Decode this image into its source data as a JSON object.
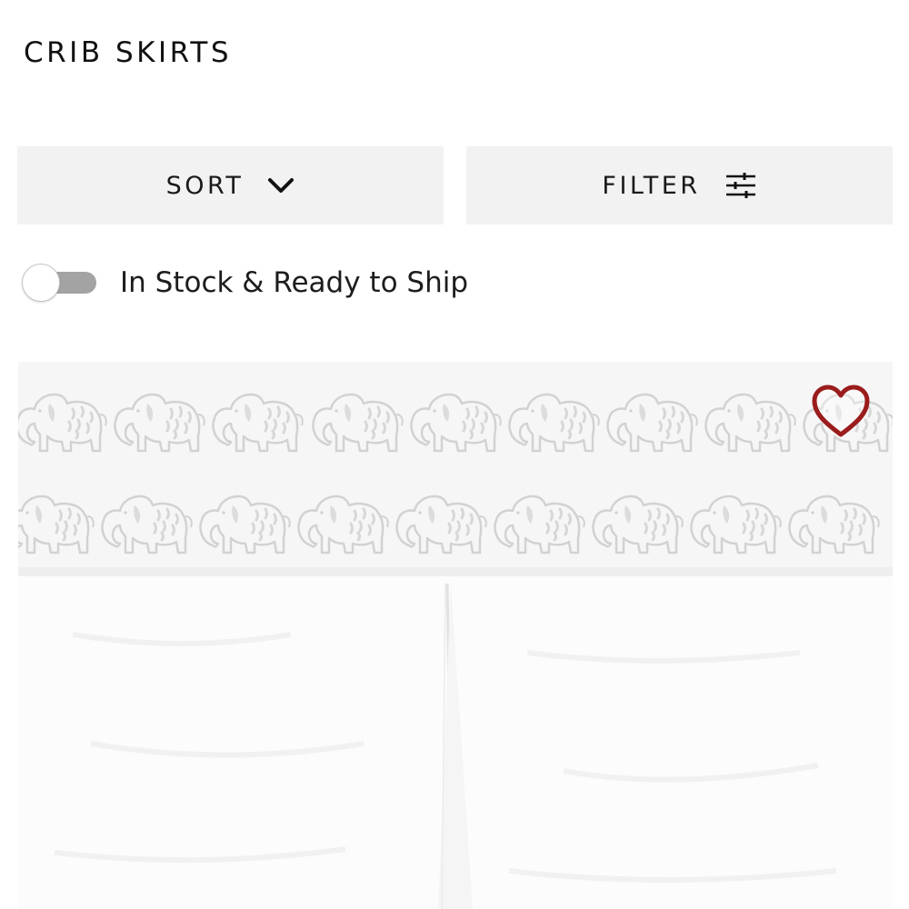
{
  "page": {
    "title": "CRIB SKIRTS"
  },
  "controls": {
    "sort_label": "SORT",
    "sort_icon": "chevron-down-icon",
    "filter_label": "FILTER",
    "filter_icon": "sliders-icon"
  },
  "stock_toggle": {
    "label": "In Stock & Ready to Ship",
    "on": false
  },
  "product": {
    "favorite_icon": "heart-outline-icon",
    "colors": {
      "heart": "#9b1c1c",
      "elephant_print": "#d5d5d5",
      "toggle_track": "#a3a3a3",
      "button_bg": "#f2f2f2"
    }
  }
}
